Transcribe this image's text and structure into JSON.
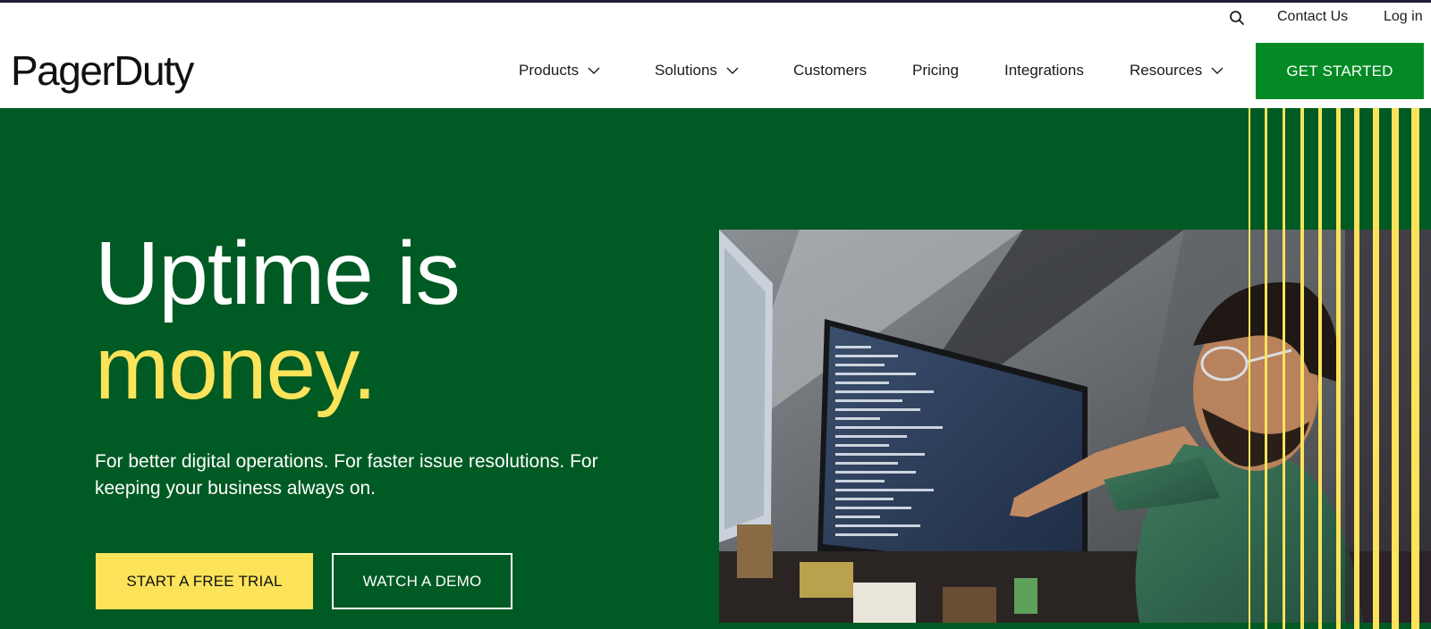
{
  "colors": {
    "hero_bg": "#005a24",
    "accent_yellow": "#fce35a",
    "cta_green": "#048a24",
    "top_strip": "#1c1d3a"
  },
  "utility_nav": {
    "search_icon": "search-icon",
    "contact": "Contact Us",
    "login": "Log in"
  },
  "header": {
    "logo": "PagerDuty",
    "nav": [
      {
        "label": "Products",
        "dropdown": true
      },
      {
        "label": "Solutions",
        "dropdown": true
      },
      {
        "label": "Customers",
        "dropdown": false
      },
      {
        "label": "Pricing",
        "dropdown": false
      },
      {
        "label": "Integrations",
        "dropdown": false
      },
      {
        "label": "Resources",
        "dropdown": true
      }
    ],
    "cta": "GET STARTED"
  },
  "hero": {
    "title_line1": "Uptime is",
    "title_line2": "money.",
    "subtitle": "For better digital operations. For faster issue resolutions. For keeping your business always on.",
    "primary_button": "START A FREE TRIAL",
    "secondary_button": "WATCH A DEMO"
  }
}
